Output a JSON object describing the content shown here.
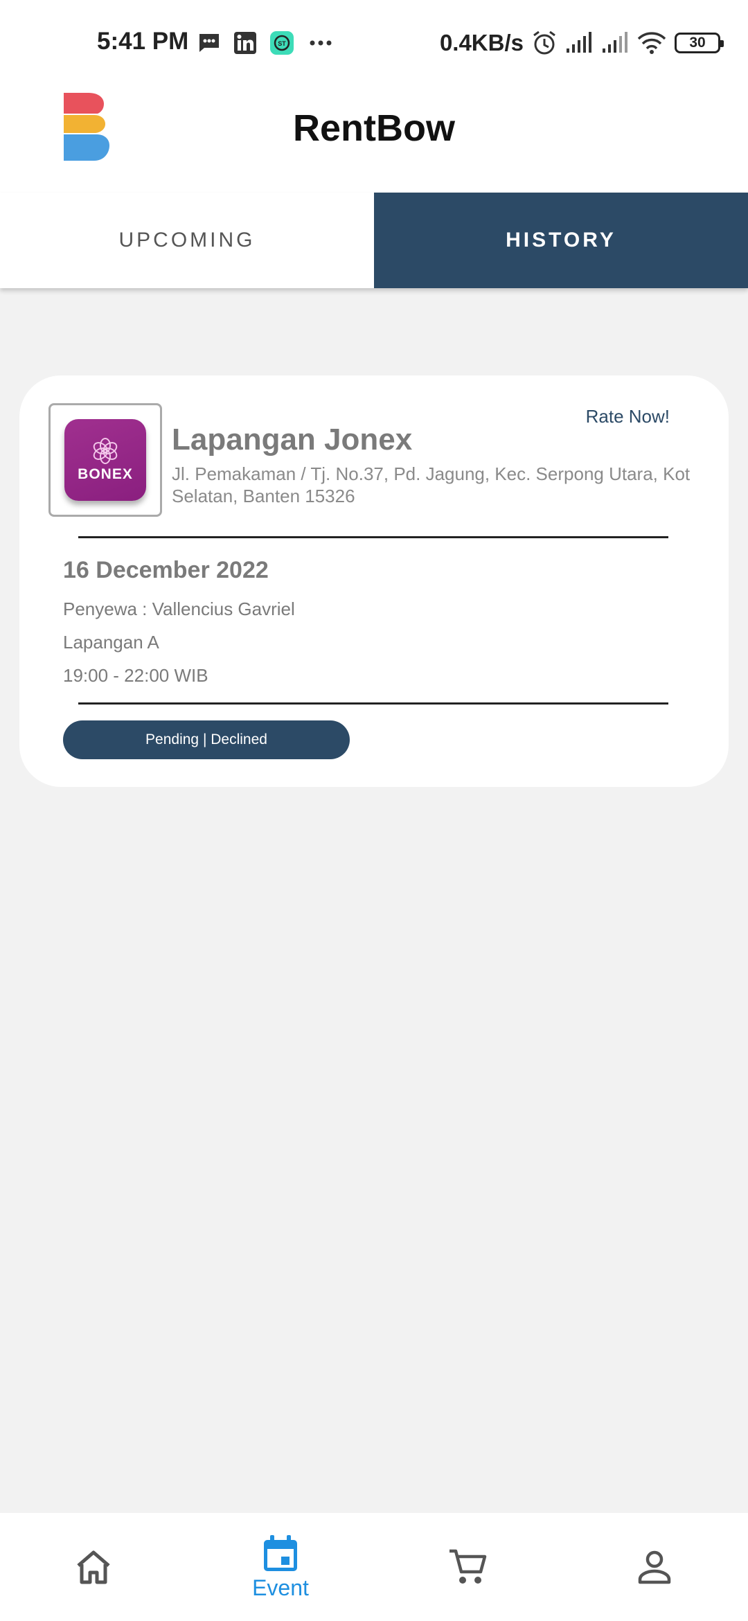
{
  "status_bar": {
    "time": "5:41 PM",
    "network_speed": "0.4KB/s",
    "battery": "30",
    "left_icons": [
      "message-icon",
      "linkedin-icon",
      "app-icon",
      "more-icon"
    ],
    "right_icons": [
      "alarm-icon",
      "signal-icon",
      "signal-icon",
      "wifi-icon",
      "battery-icon"
    ]
  },
  "header": {
    "title": "RentBow",
    "logo_colors": [
      "#e8525c",
      "#f2b233",
      "#4a9ee0"
    ]
  },
  "tabs": [
    {
      "label": "UPCOMING",
      "active": false
    },
    {
      "label": "HISTORY",
      "active": true
    }
  ],
  "booking": {
    "venue_name": "Lapangan Jonex",
    "venue_logo_text": "BONEX",
    "venue_address": "Jl. Pemakaman / Tj. No.37, Pd. Jagung, Kec. Serpong Utara, Kot Selatan, Banten 15326",
    "rate_label": "Rate Now!",
    "date": "16 December 2022",
    "renter": "Penyewa : Vallencius Gavriel",
    "court": "Lapangan A",
    "time": "19:00 - 22:00 WIB",
    "status": "Pending | Declined"
  },
  "bottom_nav": {
    "items": [
      {
        "icon": "home-icon",
        "label": "",
        "active": false
      },
      {
        "icon": "calendar-icon",
        "label": "Event",
        "active": true
      },
      {
        "icon": "cart-icon",
        "label": "",
        "active": false
      },
      {
        "icon": "profile-icon",
        "label": "",
        "active": false
      }
    ]
  },
  "colors": {
    "primary": "#2c4a66",
    "accent": "#1e8fe0",
    "background": "#f2f2f2"
  }
}
